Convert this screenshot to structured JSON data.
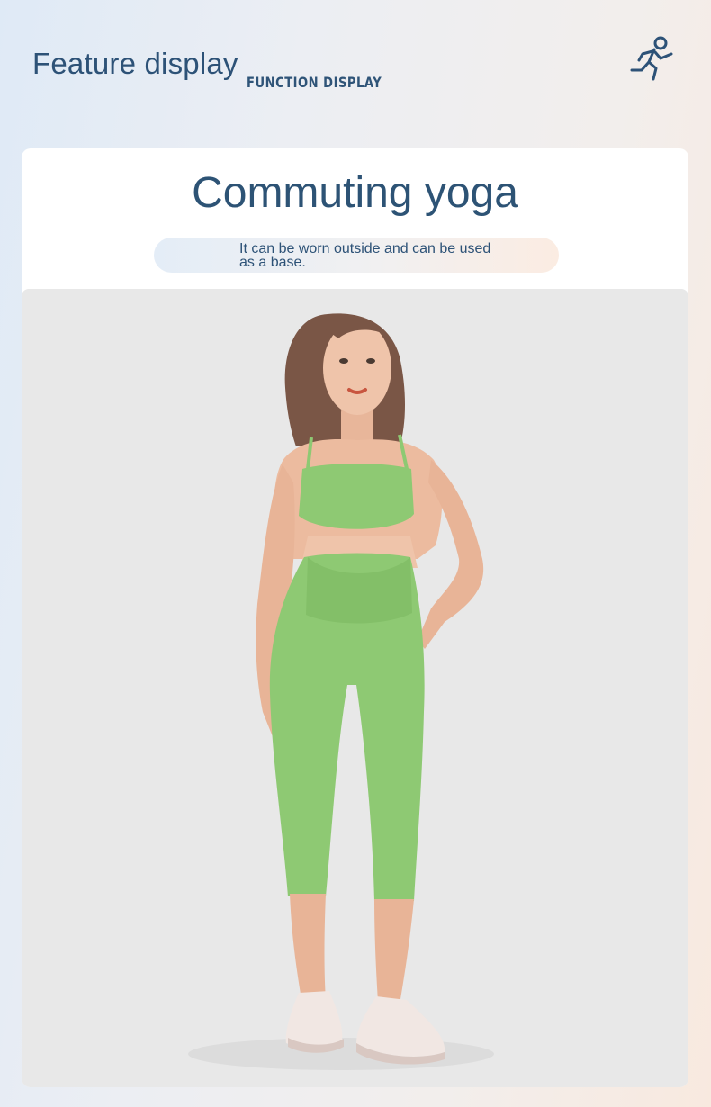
{
  "header": {
    "title": "Feature display",
    "subtitle": "FUNCTION DISPLAY",
    "icon": "running-person-icon"
  },
  "card": {
    "title": "Commuting yoga",
    "description": "It can be worn outside and can be used as a base."
  },
  "photo": {
    "subject": "model-photo",
    "colors": {
      "background": "#e8e8e8",
      "outfit": "#8ec973",
      "accent": "#2d5277"
    }
  }
}
